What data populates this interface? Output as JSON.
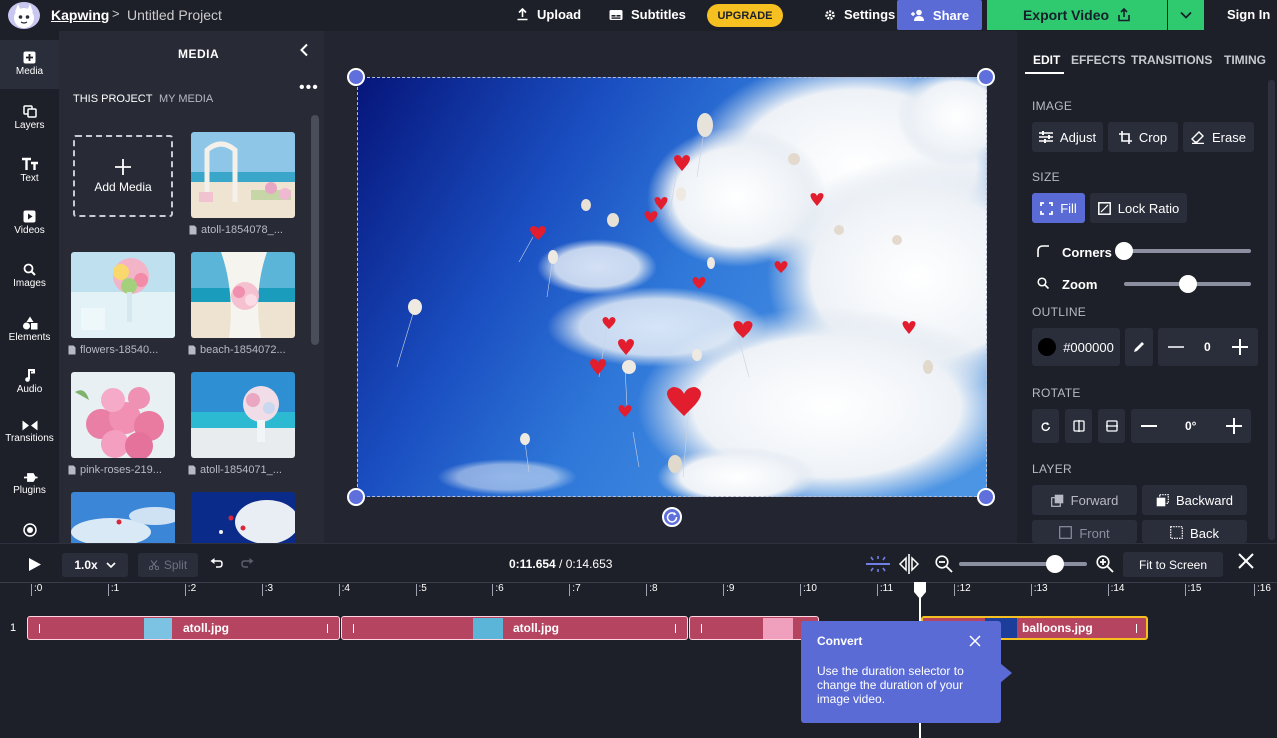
{
  "app": {
    "brand": "Kapwing",
    "separator": ">",
    "project_title": "Untitled Project"
  },
  "topbar": {
    "upload": "Upload",
    "subtitles": "Subtitles",
    "upgrade": "UPGRADE",
    "settings": "Settings",
    "share": "Share",
    "export": "Export Video",
    "signin": "Sign In"
  },
  "rail": [
    {
      "label": "Media",
      "icon": "media-icon"
    },
    {
      "label": "Layers",
      "icon": "layers-icon"
    },
    {
      "label": "Text",
      "icon": "text-icon"
    },
    {
      "label": "Videos",
      "icon": "videos-icon"
    },
    {
      "label": "Images",
      "icon": "images-icon"
    },
    {
      "label": "Elements",
      "icon": "elements-icon"
    },
    {
      "label": "Audio",
      "icon": "audio-icon"
    },
    {
      "label": "Transitions",
      "icon": "transitions-icon"
    },
    {
      "label": "Plugins",
      "icon": "plugins-icon"
    }
  ],
  "media": {
    "title": "MEDIA",
    "tab_project": "THIS PROJECT",
    "tab_mine": "MY MEDIA",
    "add_label": "Add Media",
    "items": [
      {
        "caption": "atoll-1854078_..."
      },
      {
        "caption": "flowers-18540..."
      },
      {
        "caption": "beach-1854072..."
      },
      {
        "caption": "pink-roses-219..."
      },
      {
        "caption": "atoll-1854071_..."
      }
    ]
  },
  "right": {
    "tabs": [
      "EDIT",
      "EFFECTS",
      "TRANSITIONS",
      "TIMING"
    ],
    "image_section": "IMAGE",
    "adjust": "Adjust",
    "crop": "Crop",
    "erase": "Erase",
    "size_section": "SIZE",
    "fill": "Fill",
    "lock_ratio": "Lock Ratio",
    "corners": "Corners",
    "corners_level": 0.0,
    "zoom": "Zoom",
    "zoom_level": 0.5,
    "outline_section": "OUTLINE",
    "outline_color": "#000000",
    "outline_value": "0",
    "rotate_section": "ROTATE",
    "rotate_value": "0°",
    "layer_section": "LAYER",
    "forward": "Forward",
    "backward": "Backward",
    "front": "Front",
    "back": "Back"
  },
  "timeline": {
    "speed": "1.0x",
    "split": "Split",
    "current_time": "0:11.654",
    "separator": " / ",
    "total_time": "0:14.653",
    "fit": "Fit to Screen",
    "zoom_level": 0.75,
    "ticks": [
      ":0",
      ":1",
      ":2",
      ":3",
      ":4",
      ":5",
      ":6",
      ":7",
      ":8",
      ":9",
      ":10",
      ":11",
      ":12",
      ":13",
      ":14",
      ":15",
      ":16"
    ],
    "track_number": "1",
    "clips": [
      "atoll.jpg",
      "atoll.jpg",
      "",
      "balloons.jpg"
    ]
  },
  "tooltip": {
    "title": "Convert",
    "body": "Use the duration selector to change the duration of your image video."
  },
  "colors": {
    "accent": "#5a6bd6",
    "export": "#2fc96f",
    "upgrade": "#f5c020",
    "clip": "#b4445f",
    "clip_selected_border": "#f5c020"
  }
}
